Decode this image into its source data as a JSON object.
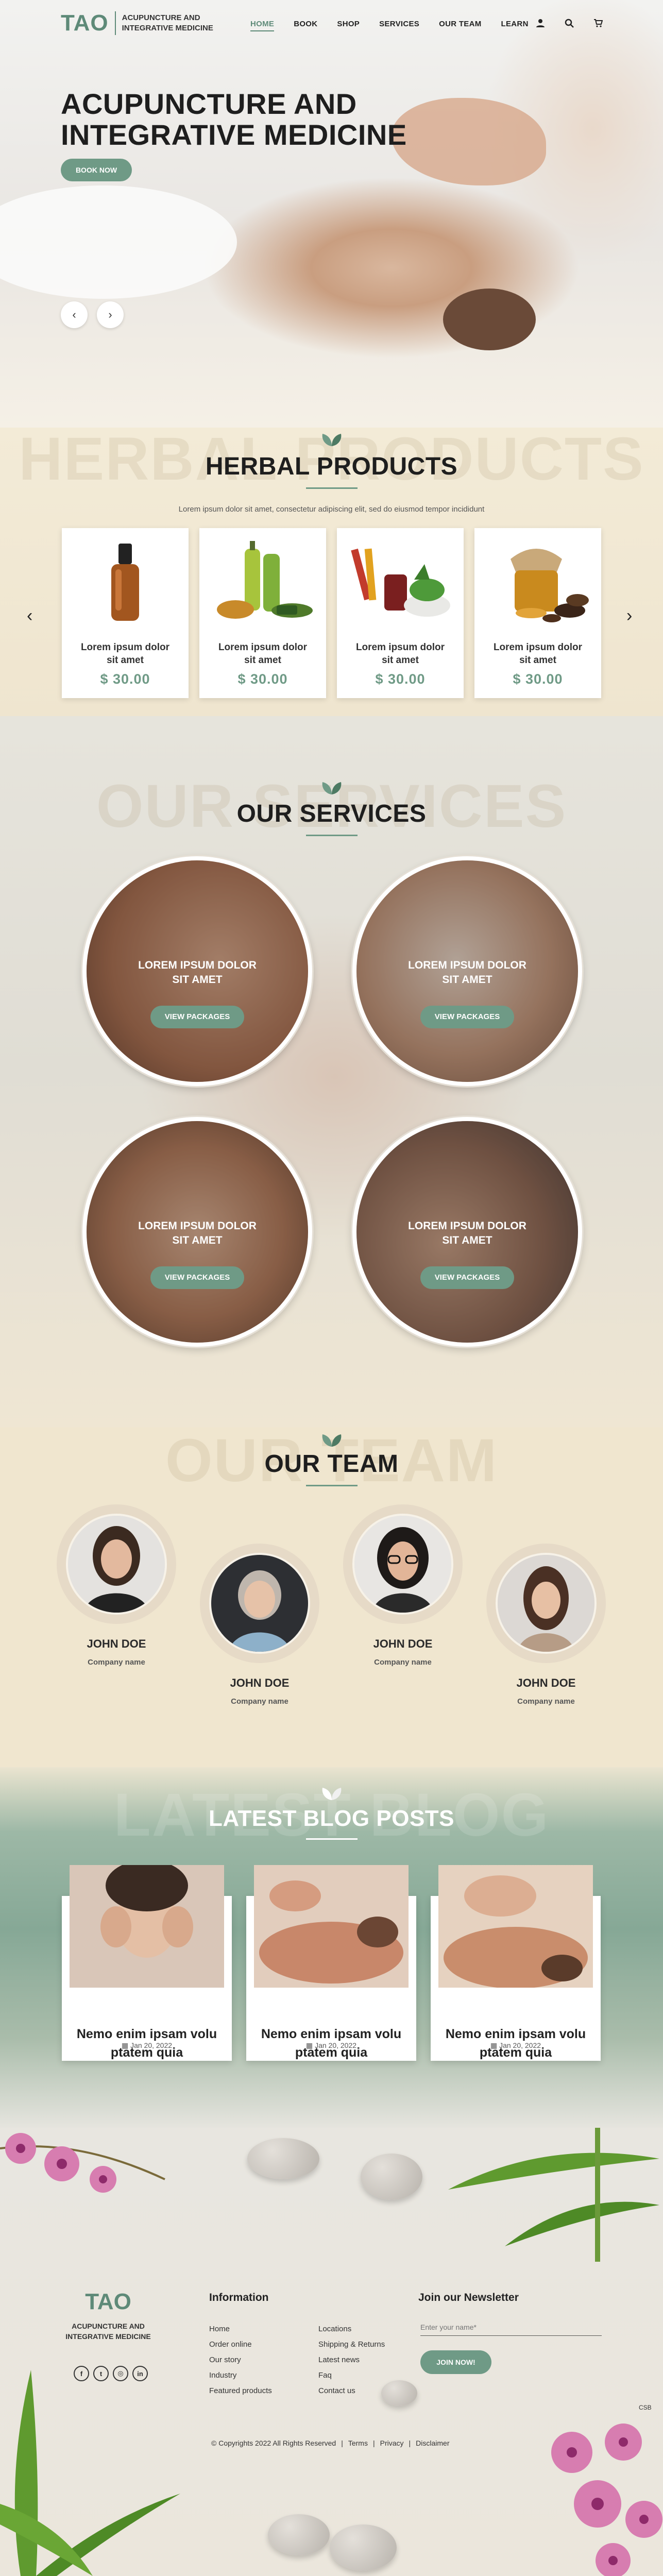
{
  "header": {
    "logo": "TAO",
    "logo_sub_line1": "ACUPUNCTURE AND",
    "logo_sub_line2": "INTEGRATIVE MEDICINE",
    "nav": [
      "HOME",
      "BOOK",
      "SHOP",
      "SERVICES",
      "OUR TEAM",
      "LEARN"
    ],
    "icons": [
      "user-icon",
      "search-icon",
      "cart-icon"
    ]
  },
  "hero": {
    "title_line1": "ACUPUNCTURE AND",
    "title_line2": "INTEGRATIVE MEDICINE",
    "cta": "BOOK NOW",
    "prev": "‹",
    "next": "›"
  },
  "products": {
    "ghost": "HERBAL PRODUCTS",
    "title": "HERBAL PRODUCTS",
    "subtitle": "Lorem ipsum dolor sit amet, consectetur adipiscing elit, sed do eiusmod tempor incididunt",
    "items": [
      {
        "name_line1": "Lorem ipsum dolor",
        "name_line2": "sit amet",
        "price": "$ 30.00"
      },
      {
        "name_line1": "Lorem ipsum dolor",
        "name_line2": "sit amet",
        "price": "$ 30.00"
      },
      {
        "name_line1": "Lorem ipsum dolor",
        "name_line2": "sit amet",
        "price": "$ 30.00"
      },
      {
        "name_line1": "Lorem ipsum dolor",
        "name_line2": "sit amet",
        "price": "$ 30.00"
      }
    ],
    "prev": "‹",
    "next": "›"
  },
  "services": {
    "ghost": "OUR SERVICES",
    "title": "OUR SERVICES",
    "items": [
      {
        "text_line1": "LOREM IPSUM DOLOR",
        "text_line2": "SIT AMET",
        "button": "VIEW PACKAGES"
      },
      {
        "text_line1": "LOREM IPSUM DOLOR",
        "text_line2": "SIT AMET",
        "button": "VIEW PACKAGES"
      },
      {
        "text_line1": "LOREM IPSUM DOLOR",
        "text_line2": "SIT AMET",
        "button": "VIEW PACKAGES"
      },
      {
        "text_line1": "LOREM IPSUM DOLOR",
        "text_line2": "SIT AMET",
        "button": "VIEW PACKAGES"
      }
    ]
  },
  "team": {
    "ghost": "OUR TEAM",
    "title": "OUR TEAM",
    "members": [
      {
        "name": "JOHN DOE",
        "company": "Company name"
      },
      {
        "name": "JOHN DOE",
        "company": "Company name"
      },
      {
        "name": "JOHN DOE",
        "company": "Company name"
      },
      {
        "name": "JOHN DOE",
        "company": "Company name"
      }
    ]
  },
  "blog": {
    "ghost": "LATEST BLOG",
    "title": "LATEST BLOG POSTS",
    "posts": [
      {
        "title_line1": "Nemo enim ipsam volu",
        "title_line2": "ptatem quia",
        "date": "Jan 20, 2022"
      },
      {
        "title_line1": "Nemo enim ipsam volu",
        "title_line2": "ptatem quia",
        "date": "Jan 20, 2022"
      },
      {
        "title_line1": "Nemo enim ipsam volu",
        "title_line2": "ptatem quia",
        "date": "Jan 20, 2022"
      }
    ]
  },
  "footer": {
    "logo": "TAO",
    "logo_sub_line1": "ACUPUNCTURE AND",
    "logo_sub_line2": "INTEGRATIVE MEDICINE",
    "social": [
      "f",
      "t",
      "◎",
      "in"
    ],
    "info_heading": "Information",
    "info_col1": [
      "Home",
      "Order online",
      "Our story",
      "Industry",
      "Featured products"
    ],
    "info_col2": [
      "Locations",
      "Shipping & Returns",
      "Latest news",
      "Faq",
      "Contact us"
    ],
    "newsletter_heading": "Join our Newsletter",
    "newsletter_placeholder": "Enter your name*",
    "newsletter_button": "JOIN NOW!",
    "copyright": "© Copyrights 2022 All Rights Reserved",
    "legal": [
      "Terms",
      "Privacy",
      "Disclaimer"
    ],
    "corner_text": "CSB"
  },
  "colors": {
    "accent": "#6f9a86",
    "text": "#222222",
    "cream": "#efe6d3"
  }
}
